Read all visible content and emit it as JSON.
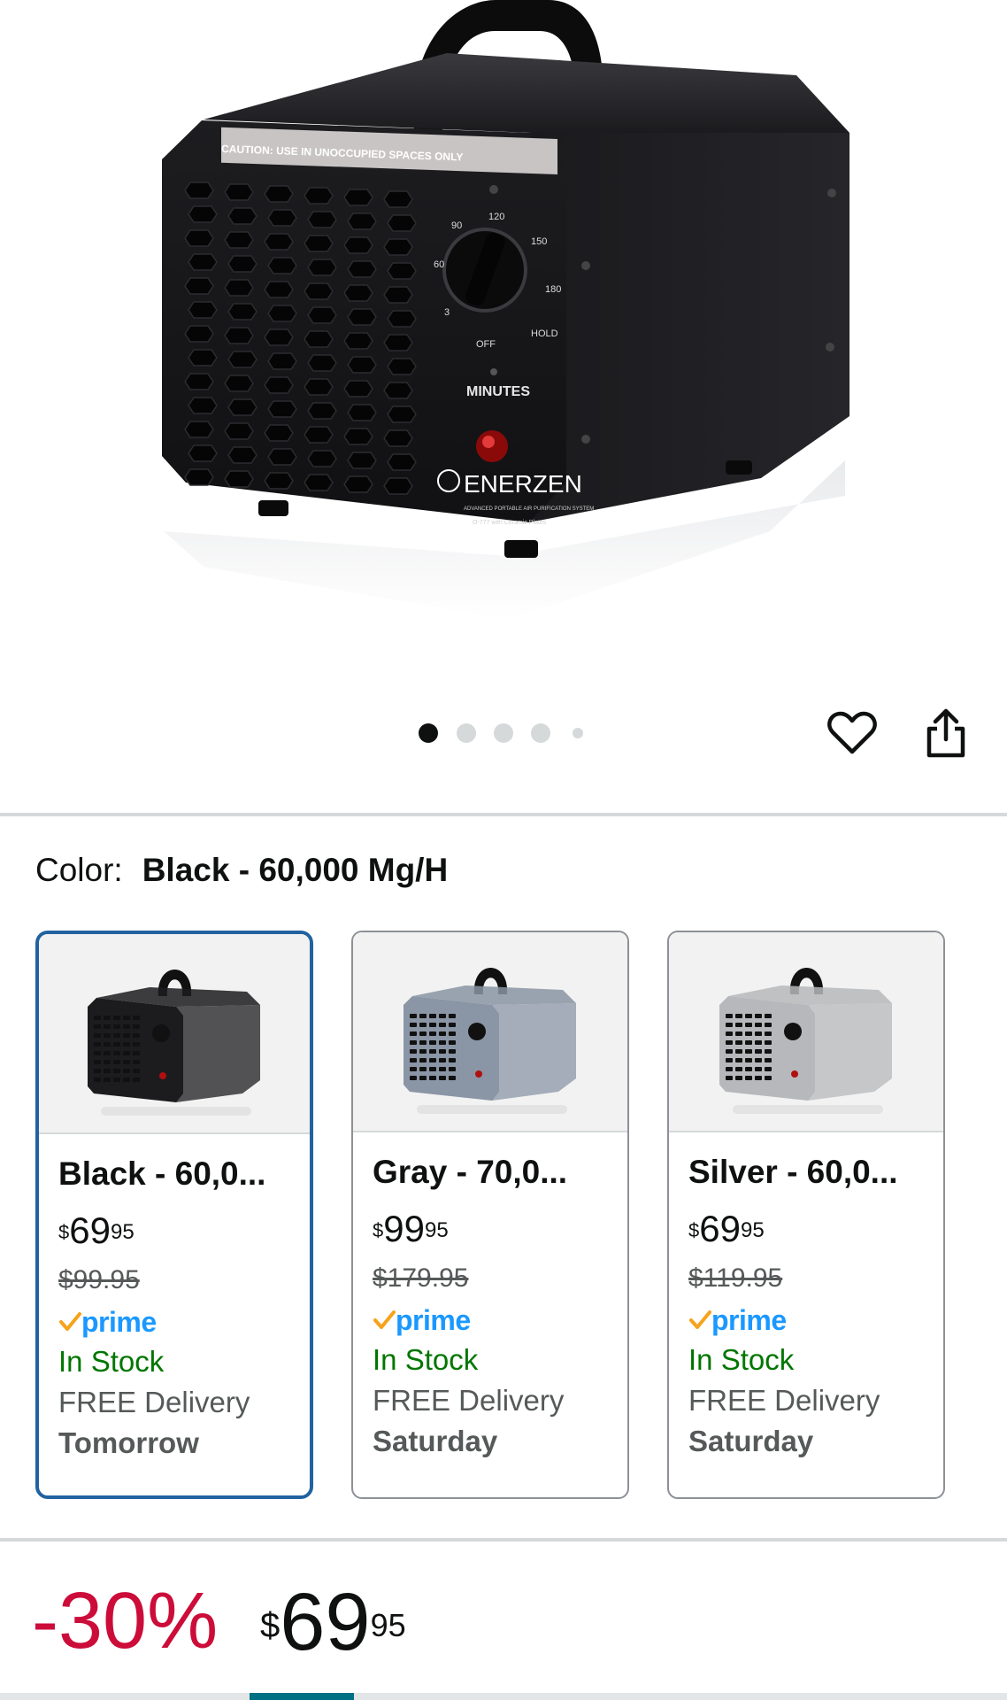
{
  "hero": {
    "image_alt": "Enerzen O-777 ozone generator, black",
    "caution_text": "CAUTION: USE IN UNOCCUPIED SPACES ONLY",
    "dial_labels": [
      "90",
      "120",
      "150",
      "180",
      "60",
      "3",
      "OFF",
      "HOLD"
    ],
    "minutes_label": "MINUTES",
    "brand": "ENERZEN",
    "tagline": "ADVANCED PORTABLE AIR PURIFICATION SYSTEM",
    "model": "O-777 with Ceramic Plates",
    "dots_count": 5,
    "active_dot": 0
  },
  "actions": {
    "wishlist_icon": "heart-icon",
    "share_icon": "share-icon"
  },
  "color": {
    "label": "Color:",
    "value": "Black - 60,000 Mg/H"
  },
  "options": [
    {
      "name": "Black - 60,0...",
      "currency": "$",
      "price_whole": "69",
      "price_cents": "95",
      "was_price": "$99.95",
      "prime": "prime",
      "stock": "In Stock",
      "delivery": "FREE Delivery",
      "delivery_day": "Tomorrow",
      "body_color": "#1c1c1f",
      "selected": true
    },
    {
      "name": "Gray - 70,0...",
      "currency": "$",
      "price_whole": "99",
      "price_cents": "95",
      "was_price": "$179.95",
      "prime": "prime",
      "stock": "In Stock",
      "delivery": "FREE Delivery",
      "delivery_day": "Saturday",
      "body_color": "#8a95a5",
      "selected": false
    },
    {
      "name": "Silver - 60,0...",
      "currency": "$",
      "price_whole": "69",
      "price_cents": "95",
      "was_price": "$119.95",
      "prime": "prime",
      "stock": "In Stock",
      "delivery": "FREE Delivery",
      "delivery_day": "Saturday",
      "body_color": "#b6b8bb",
      "selected": false
    }
  ],
  "price": {
    "discount": "-30%",
    "currency": "$",
    "whole": "69",
    "cents": "95"
  },
  "colors": {
    "discount": "#cc0c39",
    "stock": "#007600",
    "prime_blue": "#1a98ff",
    "prime_check": "#f7a21b",
    "selected_border": "#2162a1"
  }
}
